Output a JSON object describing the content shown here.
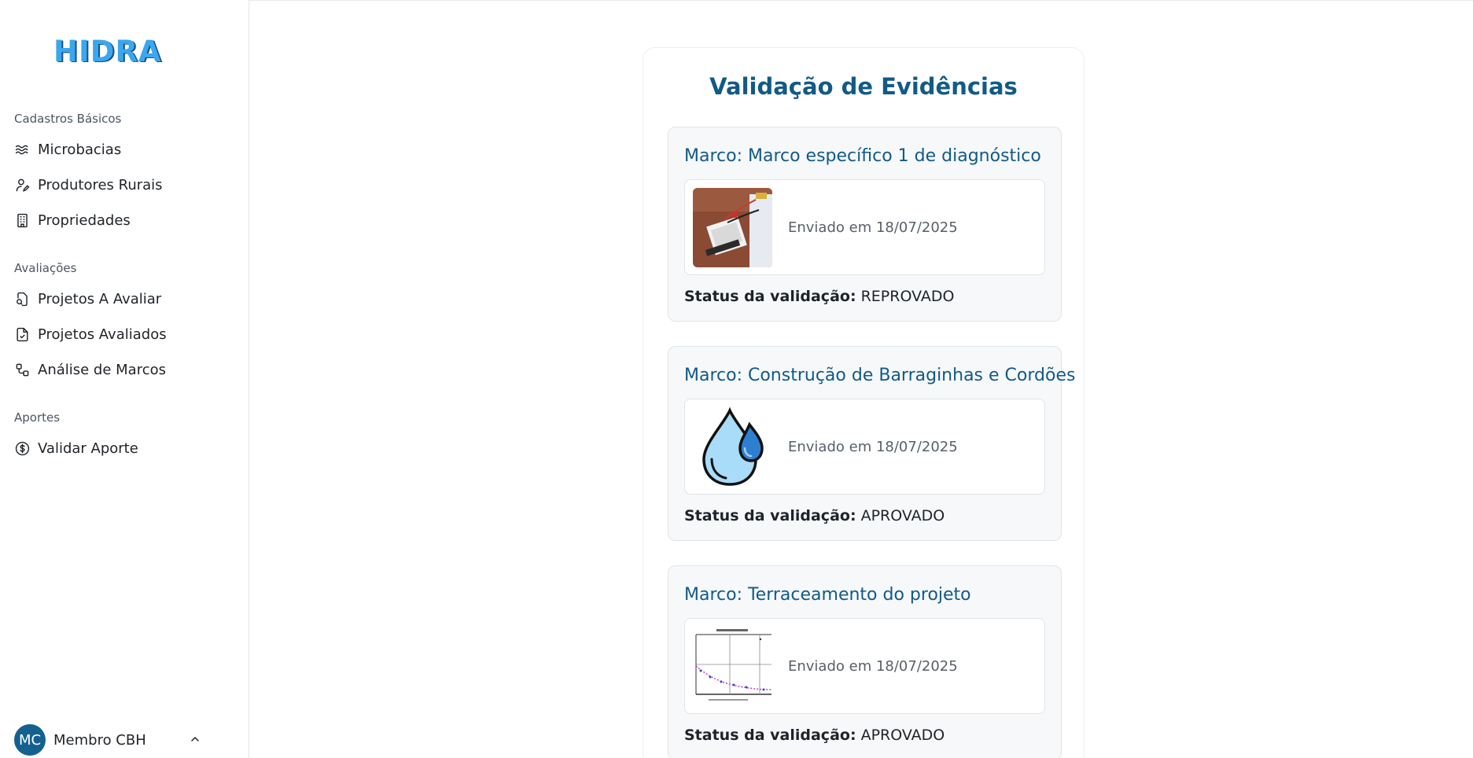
{
  "app": {
    "logo": "HIDRA"
  },
  "sidebar": {
    "groups": [
      {
        "heading": "Cadastros Básicos",
        "items": [
          {
            "label": "Microbacias",
            "icon": "waves-icon"
          },
          {
            "label": "Produtores Rurais",
            "icon": "user-pen-icon"
          },
          {
            "label": "Propriedades",
            "icon": "building-icon"
          }
        ]
      },
      {
        "heading": "Avaliações",
        "items": [
          {
            "label": "Projetos A Avaliar",
            "icon": "file-search-icon"
          },
          {
            "label": "Projetos Avaliados",
            "icon": "file-check-icon"
          },
          {
            "label": "Análise de Marcos",
            "icon": "workflow-icon"
          }
        ]
      },
      {
        "heading": "Aportes",
        "items": [
          {
            "label": "Validar Aporte",
            "icon": "dollar-circle-icon"
          }
        ]
      }
    ],
    "user": {
      "initials": "MC",
      "name": "Membro CBH"
    }
  },
  "main": {
    "title": "Validação de Evidências",
    "status_label": "Status da validação:",
    "evidences": [
      {
        "title": "Marco: Marco específico 1 de diagnóstico",
        "sent": "Enviado em 18/07/2025",
        "status": "REPROVADO",
        "thumb": "breadboard-photo"
      },
      {
        "title": "Marco: Construção de Barraginhas e Cordões",
        "sent": "Enviado em 18/07/2025",
        "status": "APROVADO",
        "thumb": "water-drops-icon"
      },
      {
        "title": "Marco: Terraceamento do projeto",
        "sent": "Enviado em 18/07/2025",
        "status": "APROVADO",
        "thumb": "plot-image"
      }
    ]
  },
  "colors": {
    "accent": "#125a86",
    "avatar": "#14618f",
    "logo": "#3aa7ee"
  }
}
